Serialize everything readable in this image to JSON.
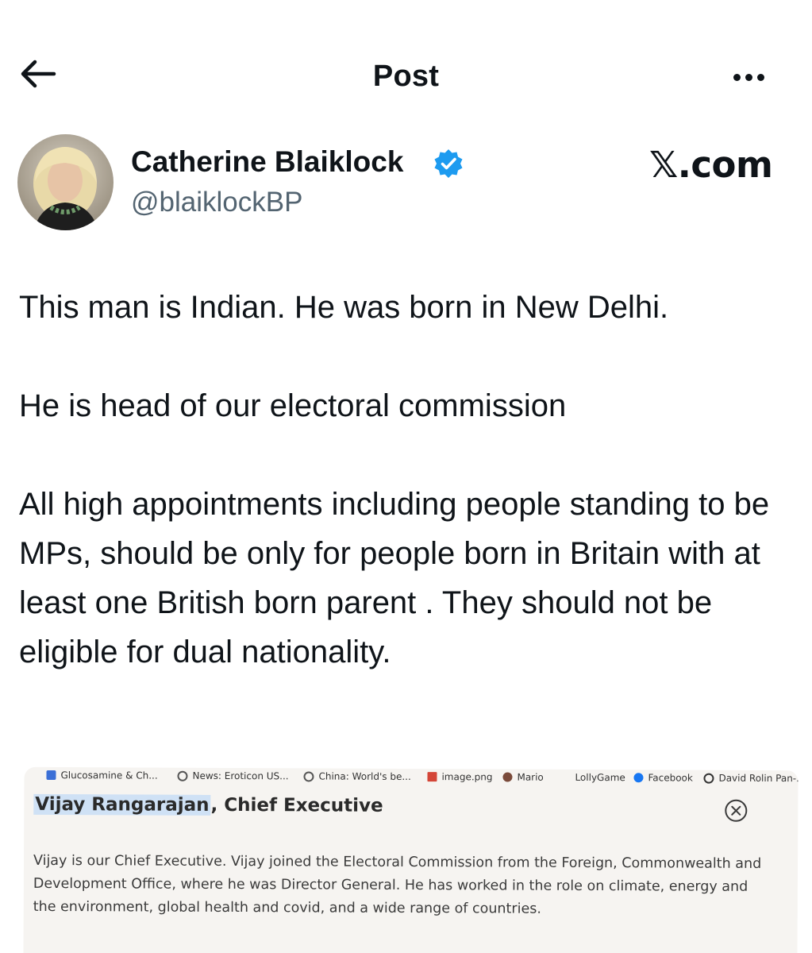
{
  "header": {
    "title": "Post",
    "back_icon": "arrow-left-icon",
    "more_icon": "more-horizontal-icon"
  },
  "author": {
    "name": "Catherine Blaiklock",
    "handle": "@blaiklockBP",
    "verified_icon": "verified-badge-icon",
    "verified_color": "#1d9bf0"
  },
  "watermark": "𝕏.com",
  "post": {
    "paragraphs": [
      "This man is Indian. He was born in New Delhi.",
      "He is head of our electoral commission",
      "All high appointments including people standing to be MPs,  should be only for people born in Britain with at least one British born parent . They should not be eligible for dual nationality."
    ]
  },
  "media": {
    "bookmarks": [
      "Glucosamine & Ch...",
      "News: Eroticon US...",
      "China: World's be...",
      "image.png",
      "Mario",
      "LollyGame",
      "Facebook",
      "David Rolin Pan-..."
    ],
    "heading_name": "Vijay Rangarajan",
    "heading_rest": ", Chief Executive",
    "body": "Vijay is our Chief Executive. Vijay joined the Electoral Commission from the Foreign, Commonwealth and Development Office, where he was Director General. He has worked in the role on climate, energy and the environment, global health and covid, and a wide range of countries."
  },
  "colors": {
    "text": "#0f1419",
    "secondary_text": "#536471",
    "highlight": "#cfe1f5"
  }
}
